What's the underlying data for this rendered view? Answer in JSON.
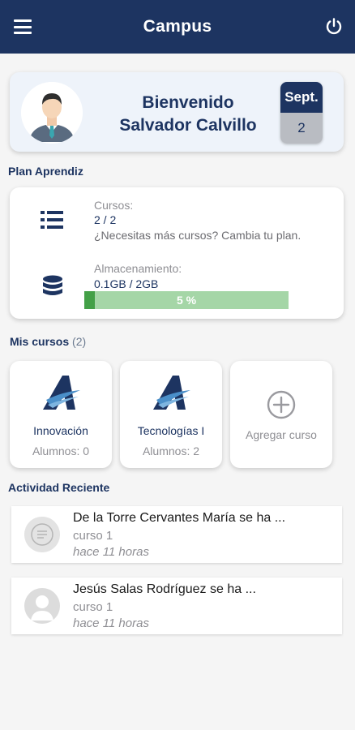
{
  "header": {
    "title": "Campus",
    "menu_icon": "hamburger-menu-icon",
    "power_icon": "power-icon",
    "background_color": "#1d3461"
  },
  "welcome": {
    "greeting": "Bienvenido",
    "user_name": "Salvador Calvillo",
    "avatar": "user-avatar-illustration",
    "date_month": "Sept.",
    "date_day": "2"
  },
  "plan": {
    "section_title": "Plan Aprendiz",
    "courses_label": "Cursos:",
    "courses_value": "2 / 2",
    "courses_hint": "¿Necesitas más cursos? Cambia tu plan.",
    "courses_icon": "list-icon",
    "storage_label": "Almacenamiento:",
    "storage_value": "0.1GB / 2GB",
    "storage_icon": "database-icon",
    "storage_percent": 5,
    "storage_percent_text": "5 %",
    "progress_color": "#43a047",
    "progress_track_color": "#a5d6a7"
  },
  "courses": {
    "section_title": "Mis cursos",
    "count_text": "(2)",
    "items": [
      {
        "name": "Innovación",
        "students": "Alumnos: 0",
        "logo": "course-logo-icon"
      },
      {
        "name": "Tecnologías I",
        "students": "Alumnos: 2",
        "logo": "course-logo-icon"
      }
    ],
    "add_label": "Agregar curso",
    "add_icon": "plus-circle-icon"
  },
  "activity": {
    "section_title": "Actividad Reciente",
    "items": [
      {
        "title": "De la Torre Cervantes María se ha ...",
        "course": "curso 1",
        "time": "hace 11 horas",
        "icon": "document-icon"
      },
      {
        "title": "Jesús Salas Rodríguez se ha ...",
        "course": "curso 1",
        "time": "hace 11 horas",
        "icon": "user-placeholder-icon"
      }
    ]
  }
}
